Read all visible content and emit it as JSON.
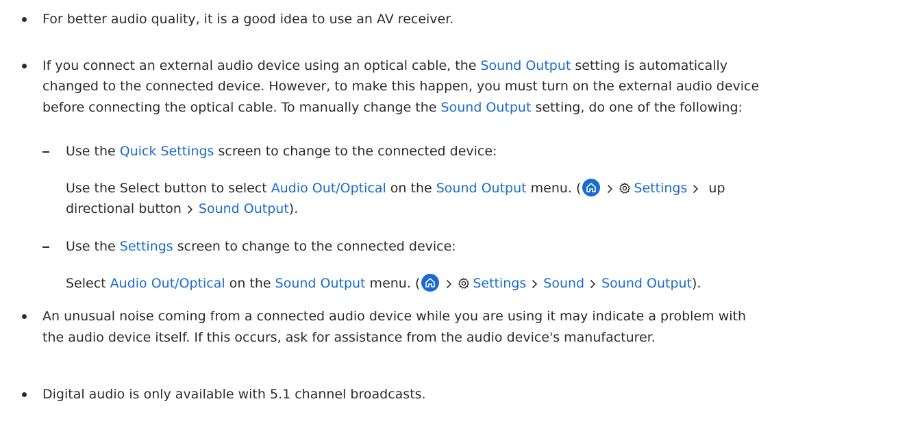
{
  "bullets": {
    "b1": "For better audio quality, it is a good idea to use an AV receiver.",
    "b2": {
      "l1_pre": "If you connect an external audio device using an optical cable, the ",
      "l1_hl": "Sound Output",
      "l1_post": " setting is automatically",
      "l2": "changed to the connected device. However, to make this happen, you must turn on the external audio device",
      "l3_pre": "before connecting the optical cable. To manually change the ",
      "l3_hl": "Sound Output",
      "l3_post": " setting, do one of the following:"
    },
    "sub1": {
      "pre": "Use the ",
      "hl": "Quick Settings",
      "post": " screen to change to the connected device:",
      "d1_pre": "Use the Select button to select ",
      "d1_hl1": "Audio Out/Optical",
      "d1_mid": " on the ",
      "d1_hl2": "Sound Output",
      "d1_post": " menu. (",
      "d1_settings": "Settings",
      "d1_up": " up",
      "d2_pre": "directional button",
      "d2_hl": "Sound Output",
      "d2_post": ")."
    },
    "sub2": {
      "pre": "Use the ",
      "hl": "Settings",
      "post": " screen to change to the connected device:",
      "d_pre": "Select ",
      "d_hl1": "Audio Out/Optical",
      "d_mid": " on the ",
      "d_hl2": "Sound Output",
      "d_post": " menu. (",
      "d_settings": "Settings",
      "d_sound": "Sound",
      "d_output": "Sound Output",
      "d_end": ")."
    },
    "b3": {
      "l1": "An unusual noise coming from a connected audio device while you are using it may indicate a problem with",
      "l2": "the audio device itself. If this occurs, ask for assistance from the audio device's manufacturer."
    },
    "b4": "Digital audio is only available with 5.1 channel broadcasts."
  },
  "colors": {
    "text": "#2b2b2b",
    "highlight": "#1a6bd0"
  },
  "icons": [
    "home-icon",
    "gear-icon",
    "chevron-right-icon"
  ]
}
